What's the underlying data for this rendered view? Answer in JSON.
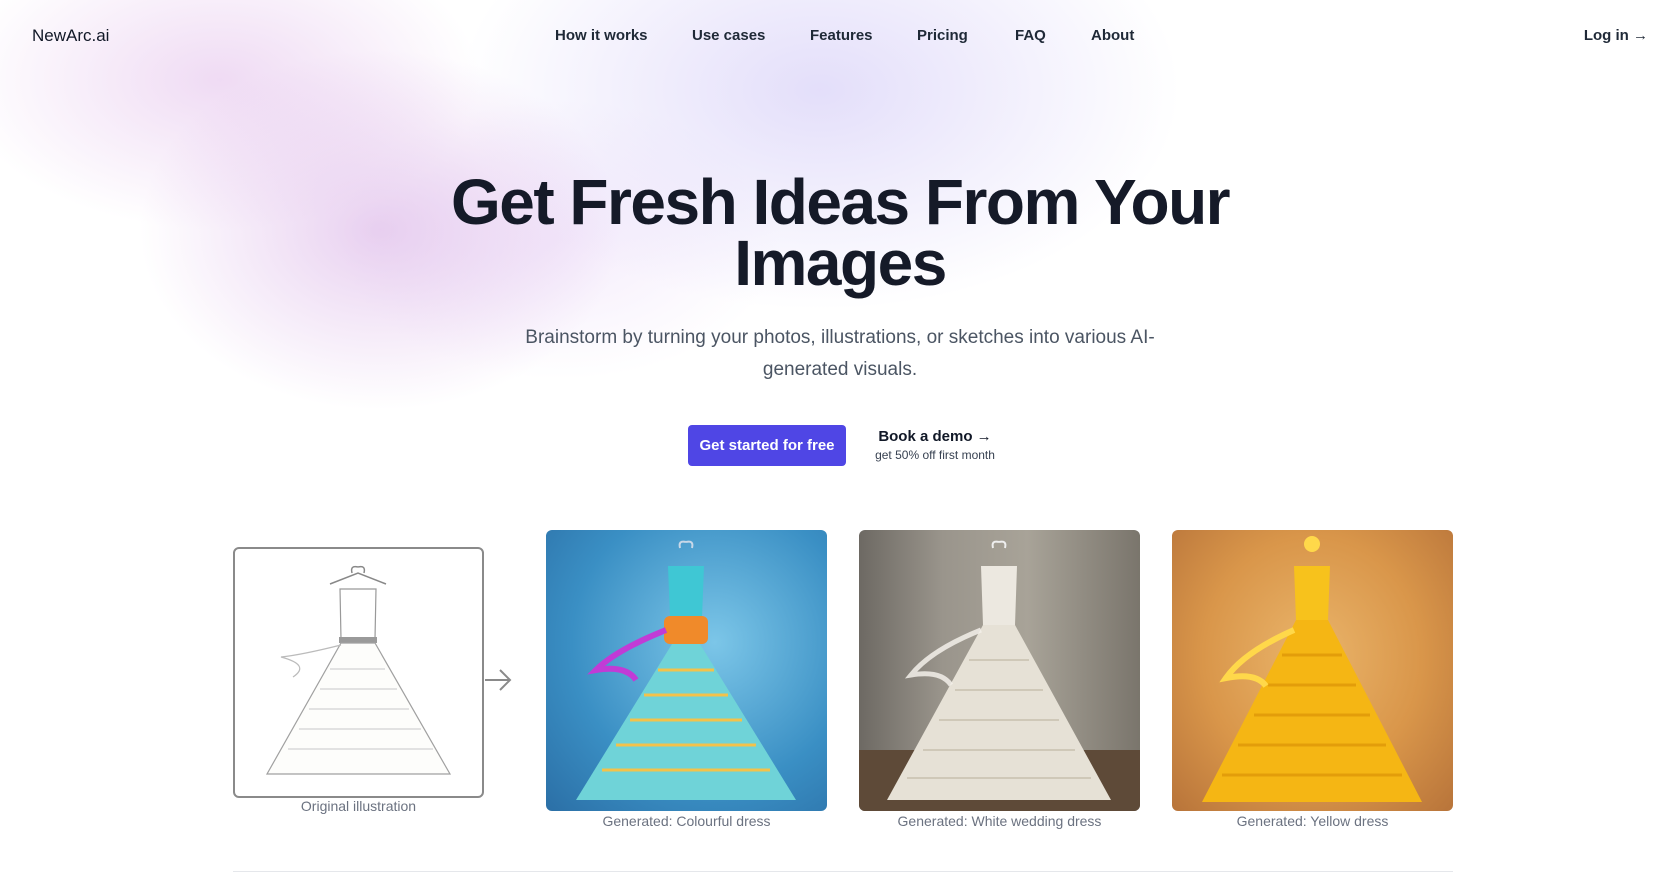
{
  "brand": {
    "name": "NewArc.ai",
    "accent": "#4f46e5"
  },
  "nav": {
    "links": [
      "How it works",
      "Use cases",
      "Features",
      "Pricing",
      "FAQ",
      "About"
    ],
    "login_label": "Log in →"
  },
  "hero": {
    "title": "Get Fresh Ideas From Your Images",
    "subtitle": "Brainstorm by turning your photos, illustrations, or sketches into various AI-generated visuals.",
    "cta_primary": "Get started for free",
    "cta_secondary": "Book a demo →",
    "cta_secondary_note": "get 50% off first month"
  },
  "showcase": {
    "original_caption": "Original illustration",
    "generated": [
      {
        "caption": "Generated: Colourful dress",
        "colors": {
          "bodice": "#3fc7d4",
          "skirt": "#6fd3d8",
          "sash": "#f08a2a",
          "ribbon": "#c13bd6"
        }
      },
      {
        "caption": "Generated: White wedding dress",
        "colors": {
          "bodice": "#ece8e0",
          "skirt": "#e6e1d6",
          "sash": "#d9d3c6",
          "ribbon": "#f3f0ea"
        }
      },
      {
        "caption": "Generated: Yellow dress",
        "colors": {
          "bodice": "#f7c21c",
          "skirt": "#f5b614",
          "sash": "#f0a10c",
          "ribbon": "#ffd84a"
        }
      }
    ],
    "icons": [
      "arrow-right-icon"
    ]
  }
}
